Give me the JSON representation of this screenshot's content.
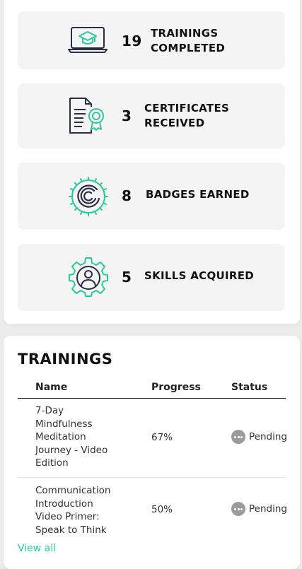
{
  "colors": {
    "accent": "#2ec99a",
    "icon_stroke": "#2a2d45",
    "tile_bg": "#f4f4f4",
    "status_grey": "#9b9b9b"
  },
  "stats": [
    {
      "icon": "laptop-graduation-cap-icon",
      "value": "19",
      "label_line1": "TRAININGS",
      "label_line2": "COMPLETED"
    },
    {
      "icon": "certificate-document-icon",
      "value": "3",
      "label_line1": "CERTIFICATES",
      "label_line2": "RECEIVED"
    },
    {
      "icon": "badge-gear-icon",
      "value": "8",
      "label_line1": "BADGES EARNED",
      "label_line2": ""
    },
    {
      "icon": "user-gear-icon",
      "value": "5",
      "label_line1": "SKILLS ACQUIRED",
      "label_line2": ""
    }
  ],
  "trainings": {
    "title": "TRAININGS",
    "columns": {
      "name": "Name",
      "progress": "Progress",
      "status": "Status"
    },
    "rows": [
      {
        "name_lines": [
          "7-Day",
          "Mindfulness",
          "Meditation",
          "Journey - Video",
          "Edition"
        ],
        "progress": "67%",
        "status": "Pending",
        "status_icon": "more-dots-icon"
      },
      {
        "name_lines": [
          "Communication",
          "Introduction",
          "Video Primer:",
          "Speak to Think"
        ],
        "progress": "50%",
        "status": "Pending",
        "status_icon": "more-dots-icon"
      }
    ],
    "view_all": "View all"
  }
}
